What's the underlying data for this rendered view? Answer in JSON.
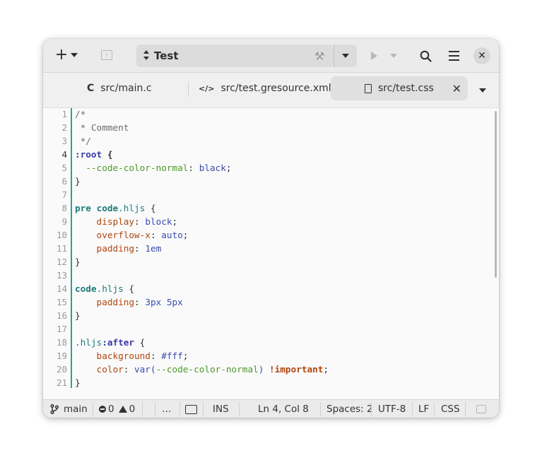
{
  "header": {
    "omnibar_title": "Test"
  },
  "tabs": [
    {
      "icon": "C",
      "label": "src/main.c"
    },
    {
      "icon": "</>",
      "label": "src/test.gresource.xml"
    },
    {
      "icon": "doc",
      "label": "src/test.css",
      "active": true,
      "close": "✕"
    }
  ],
  "editor": {
    "line_numbers": [
      "1",
      "2",
      "3",
      "4",
      "5",
      "6",
      "7",
      "8",
      "9",
      "10",
      "11",
      "12",
      "13",
      "14",
      "15",
      "16",
      "17",
      "18",
      "19",
      "20",
      "21"
    ],
    "current_line": 4,
    "code": {
      "l1": "/*",
      "l2": " * Comment",
      "l3": " */",
      "l4_sel": ":root",
      "l4_rest": " {",
      "l5_var": "  --code-color-normal",
      "l5_colon": ": ",
      "l5_val": "black",
      "l5_semi": ";",
      "l6": "}",
      "l8_pre": "pre",
      "l8_code": "code",
      "l8_cls": ".hljs",
      "l8_rest": " {",
      "l9_prop": "    display",
      "l9_val": "block",
      "l10_prop": "    overflow-x",
      "l10_val": "auto",
      "l11_prop": "    padding",
      "l11_val": "1em",
      "l12": "}",
      "l14_code": "code",
      "l14_cls": ".hljs",
      "l14_rest": " {",
      "l15_prop": "    padding",
      "l15_val": "3px 5px",
      "l16": "}",
      "l18_cls": ".hljs",
      "l18_pseudo": ":after",
      "l18_rest": " {",
      "l19_prop": "    background",
      "l19_val": "#fff",
      "l20_prop": "    color",
      "l20_fn": "var(",
      "l20_var": "--code-color-normal",
      "l20_fnclose": ")",
      "l20_imp": "!important",
      "l21": "}"
    }
  },
  "statusbar": {
    "branch": "main",
    "errors": "0",
    "warnings": "0",
    "more": "…",
    "mode": "INS",
    "position": "Ln 4, Col 8",
    "spaces": "Spaces: 2",
    "encoding": "UTF-8",
    "line_ending": "LF",
    "language": "CSS"
  },
  "colors": {
    "gutter_accent": "#2aa198",
    "keyword_purple": "#3a3aa8",
    "property_orange": "#b2450f",
    "value_blue": "#3a4bb0",
    "variable_green": "#4c9a2a",
    "selector_teal": "#1e7a7a"
  }
}
